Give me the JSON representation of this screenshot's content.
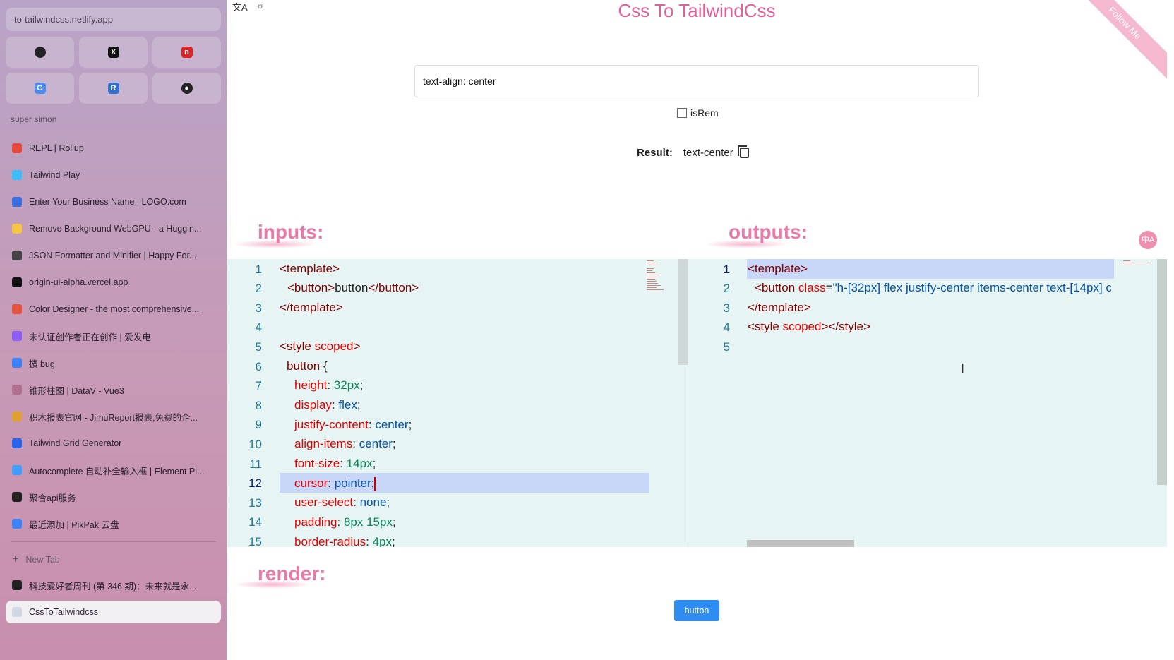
{
  "sidebar": {
    "url": "to-tailwindcss.netlify.app",
    "pins": [
      {
        "icon": "github-icon",
        "glyph": ""
      },
      {
        "icon": "x-icon",
        "glyph": "X"
      },
      {
        "icon": "red-app-icon",
        "glyph": "n"
      },
      {
        "icon": "translate-icon",
        "glyph": "G"
      },
      {
        "icon": "r-icon",
        "glyph": "R"
      },
      {
        "icon": "chat-icon",
        "glyph": "●"
      }
    ],
    "group_title": "super simon",
    "tabs": [
      {
        "label": "REPL | Rollup",
        "color": "#e8483a"
      },
      {
        "label": "Tailwind Play",
        "color": "#38bdf8"
      },
      {
        "label": "Enter Your Business Name | LOGO.com",
        "color": "#3b6fe0"
      },
      {
        "label": "Remove Background WebGPU - a Huggin...",
        "color": "#f5c542"
      },
      {
        "label": "JSON Formatter and Minifier | Happy For...",
        "color": "#444444"
      },
      {
        "label": "origin-ui-alpha.vercel.app",
        "color": "#111111"
      },
      {
        "label": "Color Designer - the most comprehensive...",
        "color": "#e5533c"
      },
      {
        "label": "未认证创作者正在创作 | 爱发电",
        "color": "#8b5cf6"
      },
      {
        "label": "擴 bug",
        "color": "#3b82f6"
      },
      {
        "label": "锥形柱图 | DataV - Vue3",
        "color": "#b07090"
      },
      {
        "label": "积木报表官网 - JimuReport报表,免费的企...",
        "color": "#e0a030"
      },
      {
        "label": "Tailwind Grid Generator",
        "color": "#2563eb"
      },
      {
        "label": "Autocomplete 自动补全输入框 | Element Pl...",
        "color": "#409eff"
      },
      {
        "label": "聚合api服务",
        "color": "#222222"
      },
      {
        "label": "最近添加 | PikPak 云盘",
        "color": "#3b82f6"
      }
    ],
    "new_tab_label": "New Tab",
    "extra_tabs": [
      {
        "label": "科技爱好者周刊 (第 346 期)：未来就是永...",
        "color": "#222222",
        "active": false
      },
      {
        "label": "CssToTailwindcss",
        "color": "#cfd8e3",
        "active": true
      }
    ]
  },
  "main": {
    "title": "Css To TailwindCss",
    "ribbon": "Follow Me",
    "input_value": "text-align: center",
    "isrem_label": "isRem",
    "result_label": "Result:",
    "result_value": "text-center",
    "inputs_label": "inputs:",
    "outputs_label": "outputs:",
    "render_label": "render:",
    "render_button": "button",
    "float_badge": "中A",
    "top_icons": [
      "文A",
      "☼"
    ]
  },
  "editor_inputs": {
    "line_numbers": [
      "1",
      "2",
      "3",
      "4",
      "5",
      "6",
      "7",
      "8",
      "9",
      "10",
      "11",
      "12",
      "13",
      "14",
      "15"
    ],
    "active_line": 12
  },
  "editor_outputs": {
    "line_numbers": [
      "1",
      "2",
      "3",
      "4",
      "5"
    ],
    "active_line": 1
  },
  "colors": {
    "accent_pink": "#e0609a",
    "editor_bg": "#e6f5f3",
    "button_blue": "#2f8cf0"
  }
}
